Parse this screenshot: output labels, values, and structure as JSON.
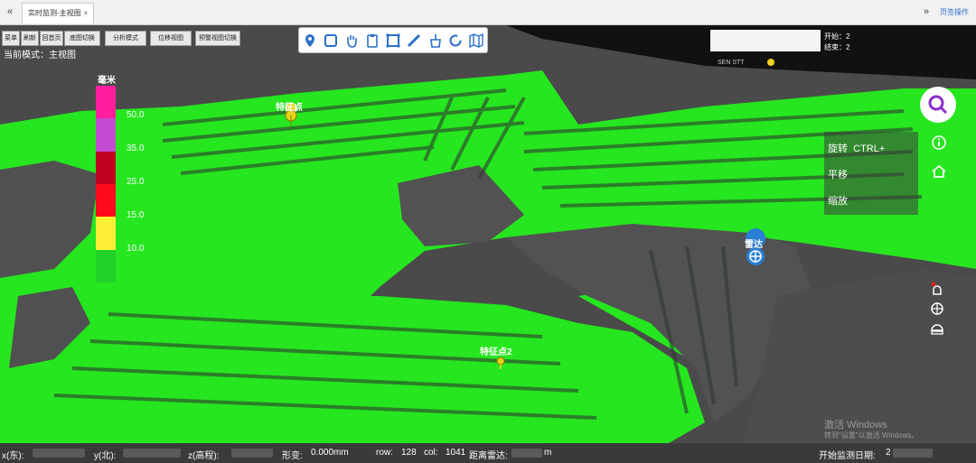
{
  "tabbar": {
    "prev": "«",
    "next": "»",
    "tab_label": "实时监测-主视图",
    "tab_close": "×",
    "ops_label": "页签操作"
  },
  "buttons": [
    "菜单",
    "刷新",
    "回首页",
    "底图切换",
    "分析模式",
    "位移视图",
    "预警视图切换"
  ],
  "mode_text": "当前模式：主视图",
  "legend": {
    "unit": "毫米",
    "colors": [
      "#ff1f9e",
      "#c24bd1",
      "#c0001f",
      "#ff0a1c",
      "#ffee33",
      "#22d02a"
    ],
    "ticks": [
      "50.0",
      "35.0",
      "25.0",
      "15.0",
      "10.0"
    ]
  },
  "toolbar_icons": [
    "location-pin-icon",
    "select-rect-icon",
    "hand-pan-icon",
    "clipboard-icon",
    "crop-icon",
    "ruler-icon",
    "brush-icon",
    "refresh-icon",
    "map-icon"
  ],
  "info": {
    "start_label": "开始：",
    "start_value": "2",
    "end_label": "结束：",
    "end_value": "2",
    "status_text": "SEN STT",
    "status_color": "#f0d020"
  },
  "controls": {
    "rotate": "旋转",
    "rotate_key": "CTRL+",
    "pan": "平移",
    "zoom": "缩放"
  },
  "markers": {
    "feature1": "特征点",
    "feature2": "特征点2",
    "radar": "雷达"
  },
  "watermark": {
    "line1": "激活 Windows",
    "line2": "转到\"设置\"以激活 Windows。"
  },
  "bottombar": {
    "x_label": "x(东):",
    "y_label": "y(北):",
    "z_label": "z(高程):",
    "deform_label": "形变:",
    "deform_value": "0.000mm",
    "row_label": "row:",
    "row_value": "128",
    "col_label": "col:",
    "col_value": "1041",
    "dist_label": "距离雷达:",
    "dist_unit": "m",
    "start_date_label": "开始监测日期:",
    "start_date_value": "2"
  }
}
